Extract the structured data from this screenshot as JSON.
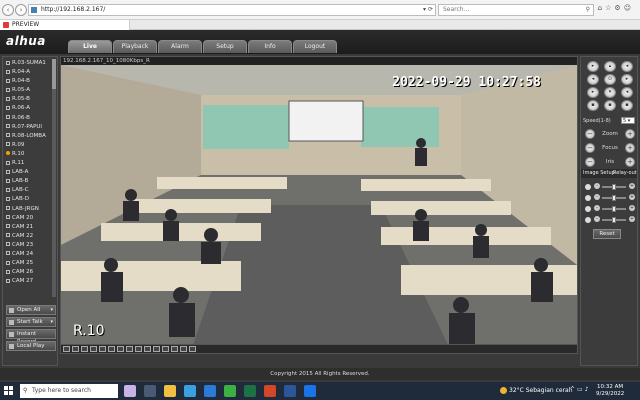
{
  "browser": {
    "url": "http://192.168.2.167/",
    "search_placeholder": "Search...",
    "tab_title": "PREVIEW"
  },
  "app": {
    "logo": "alhua",
    "tabs": [
      {
        "label": "Live",
        "active": true
      },
      {
        "label": "Playback"
      },
      {
        "label": "Alarm"
      },
      {
        "label": "Setup"
      },
      {
        "label": "Info"
      },
      {
        "label": "Logout"
      }
    ]
  },
  "cameras": [
    {
      "label": "R.03-SUMA1"
    },
    {
      "label": "R.04-A"
    },
    {
      "label": "R.04-B"
    },
    {
      "label": "R.05-A"
    },
    {
      "label": "R.05-B"
    },
    {
      "label": "R.06-A"
    },
    {
      "label": "R.06-B"
    },
    {
      "label": "R.07-PAPUI"
    },
    {
      "label": "R.08-LOMBA"
    },
    {
      "label": "R.09"
    },
    {
      "label": "R.10",
      "active": true,
      "mark": "M"
    },
    {
      "label": "R.11"
    },
    {
      "label": "LAB-A"
    },
    {
      "label": "LAB-B"
    },
    {
      "label": "LAB-C"
    },
    {
      "label": "LAB-D"
    },
    {
      "label": "LAB-JRGN"
    },
    {
      "label": "CAM 20"
    },
    {
      "label": "CAM 21"
    },
    {
      "label": "CAM 22"
    },
    {
      "label": "CAM 23"
    },
    {
      "label": "CAM 24"
    },
    {
      "label": "CAM 25"
    },
    {
      "label": "CAM 26"
    },
    {
      "label": "CAM 27"
    }
  ],
  "left_controls": {
    "open_all": "Open All",
    "start_talk": "Start Talk",
    "instant_record": "Instant Record",
    "local_play": "Local Play"
  },
  "video": {
    "info_bar": "192.168.2.167_10_1080Kbps_R",
    "timestamp": "2022-09-29 10:27:58",
    "camera_name": "R.10"
  },
  "ptz": {
    "speed_label": "Speed(1-8)",
    "speed_value": "5",
    "zoom": "Zoom",
    "focus": "Focus",
    "iris": "Iris",
    "image_setup_tab": "Image Setup",
    "relay_out_tab": "Relay-out",
    "reset": "Reset",
    "sliders": [
      0.5,
      0.5,
      0.5,
      0.5
    ]
  },
  "footer": {
    "copyright": "Copyright 2015 All Rights Reserved."
  },
  "taskbar": {
    "search_placeholder": "Type here to search",
    "weather": "32°C  Sebagian cerah",
    "time": "10:32 AM",
    "date": "9/29/2022"
  },
  "colors": {
    "header": "#1c1c1c",
    "panel": "#3c3c3c",
    "accent_active_cam": "#f0a000",
    "taskbar": "#1f2a3a"
  }
}
